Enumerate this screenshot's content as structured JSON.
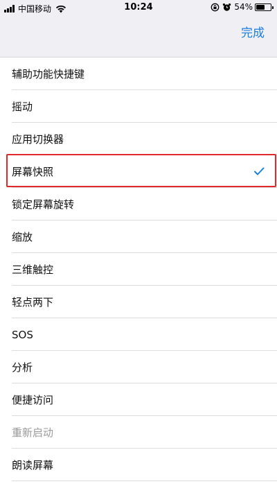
{
  "status_bar": {
    "carrier": "中国移动",
    "time": "10:24",
    "battery_percent": "54%",
    "battery_level": 0.54
  },
  "nav": {
    "done_label": "完成"
  },
  "list": {
    "items": [
      {
        "label": "辅助功能快捷键"
      },
      {
        "label": "摇动"
      },
      {
        "label": "应用切换器"
      },
      {
        "label": "屏幕快照",
        "selected": true
      },
      {
        "label": "锁定屏幕旋转"
      },
      {
        "label": "缩放"
      },
      {
        "label": "三维触控"
      },
      {
        "label": "轻点两下"
      },
      {
        "label": "SOS"
      },
      {
        "label": "分析"
      },
      {
        "label": "便捷访问"
      },
      {
        "label": "重新启动",
        "disabled": true
      },
      {
        "label": "朗读屏幕"
      },
      {
        "label": ""
      }
    ]
  },
  "colors": {
    "accent": "#1a7ee0",
    "highlight": "#e02a2a",
    "background": "#efeff4"
  }
}
